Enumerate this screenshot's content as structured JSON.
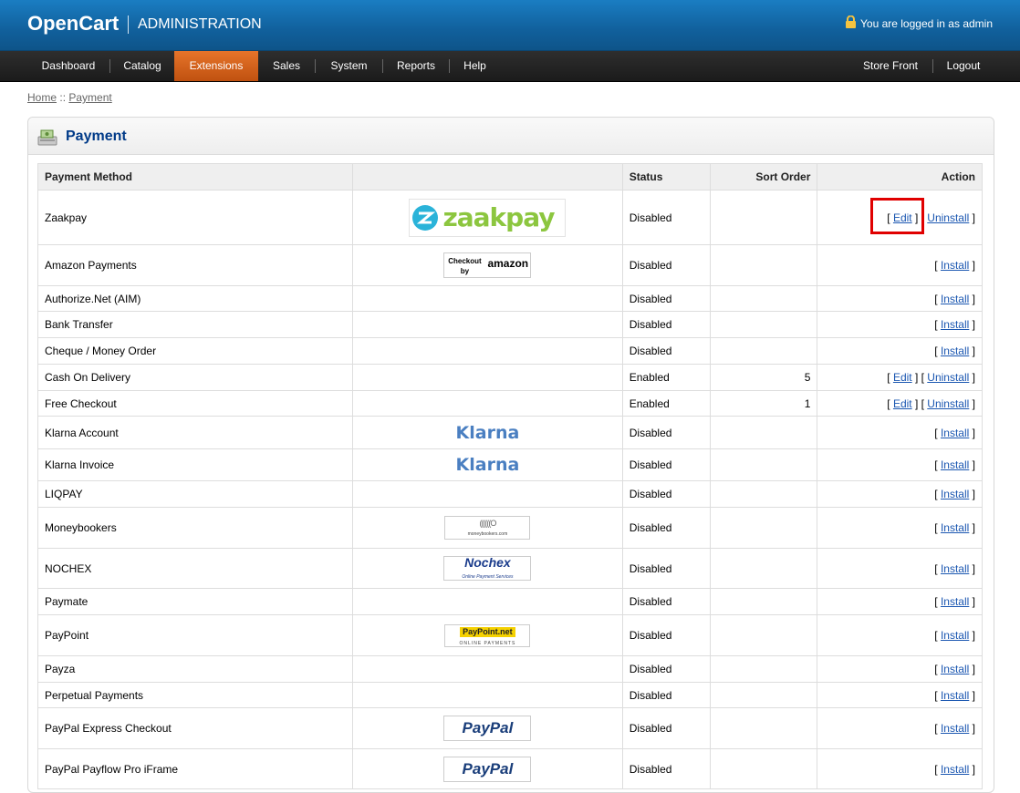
{
  "header": {
    "brand": "OpenCart",
    "subtitle": "ADMINISTRATION",
    "logged_in": "You are logged in as admin"
  },
  "menu": {
    "left": [
      "Dashboard",
      "Catalog",
      "Extensions",
      "Sales",
      "System",
      "Reports",
      "Help"
    ],
    "active": "Extensions",
    "right": [
      "Store Front",
      "Logout"
    ]
  },
  "breadcrumb": {
    "home": "Home",
    "sep": "::",
    "current": "Payment"
  },
  "page": {
    "title": "Payment"
  },
  "table": {
    "headers": [
      "Payment Method",
      "",
      "Status",
      "Sort Order",
      "Action"
    ],
    "rows": [
      {
        "name": "Zaakpay",
        "logo": "zaakpay",
        "status": "Disabled",
        "sort": "",
        "actions": [
          "Edit",
          "Uninstall"
        ]
      },
      {
        "name": "Amazon Payments",
        "logo": "amazon",
        "status": "Disabled",
        "sort": "",
        "actions": [
          "Install"
        ]
      },
      {
        "name": "Authorize.Net (AIM)",
        "logo": "",
        "status": "Disabled",
        "sort": "",
        "actions": [
          "Install"
        ]
      },
      {
        "name": "Bank Transfer",
        "logo": "",
        "status": "Disabled",
        "sort": "",
        "actions": [
          "Install"
        ]
      },
      {
        "name": "Cheque / Money Order",
        "logo": "",
        "status": "Disabled",
        "sort": "",
        "actions": [
          "Install"
        ]
      },
      {
        "name": "Cash On Delivery",
        "logo": "",
        "status": "Enabled",
        "sort": "5",
        "actions": [
          "Edit",
          "Uninstall"
        ]
      },
      {
        "name": "Free Checkout",
        "logo": "",
        "status": "Enabled",
        "sort": "1",
        "actions": [
          "Edit",
          "Uninstall"
        ]
      },
      {
        "name": "Klarna Account",
        "logo": "klarna",
        "status": "Disabled",
        "sort": "",
        "actions": [
          "Install"
        ]
      },
      {
        "name": "Klarna Invoice",
        "logo": "klarna",
        "status": "Disabled",
        "sort": "",
        "actions": [
          "Install"
        ]
      },
      {
        "name": "LIQPAY",
        "logo": "",
        "status": "Disabled",
        "sort": "",
        "actions": [
          "Install"
        ]
      },
      {
        "name": "Moneybookers",
        "logo": "moneybookers",
        "status": "Disabled",
        "sort": "",
        "actions": [
          "Install"
        ]
      },
      {
        "name": "NOCHEX",
        "logo": "nochex",
        "status": "Disabled",
        "sort": "",
        "actions": [
          "Install"
        ]
      },
      {
        "name": "Paymate",
        "logo": "",
        "status": "Disabled",
        "sort": "",
        "actions": [
          "Install"
        ]
      },
      {
        "name": "PayPoint",
        "logo": "paypoint",
        "status": "Disabled",
        "sort": "",
        "actions": [
          "Install"
        ]
      },
      {
        "name": "Payza",
        "logo": "",
        "status": "Disabled",
        "sort": "",
        "actions": [
          "Install"
        ]
      },
      {
        "name": "Perpetual Payments",
        "logo": "",
        "status": "Disabled",
        "sort": "",
        "actions": [
          "Install"
        ]
      },
      {
        "name": "PayPal Express Checkout",
        "logo": "paypal",
        "status": "Disabled",
        "sort": "",
        "actions": [
          "Install"
        ]
      },
      {
        "name": "PayPal Payflow Pro iFrame",
        "logo": "paypal",
        "status": "Disabled",
        "sort": "",
        "actions": [
          "Install"
        ]
      }
    ]
  },
  "logos": {
    "zaakpay": "zaakpay",
    "amazon_line1": "Checkout",
    "amazon_line2": "by",
    "amazon_brand": "amazon",
    "klarna": "Klarna",
    "moneybookers": "moneybookers.com",
    "nochex": "Nochex",
    "nochex_sub": "Online Payment Services",
    "paypoint": "PayPoint.net",
    "paypoint_sub": "ONLINE PAYMENTS",
    "paypal": "PayPal"
  },
  "colors": {
    "header_blue": "#11609c",
    "menu_active": "#d3611c",
    "title_blue": "#003a88",
    "link_blue": "#1b57b1",
    "highlight_red": "#e00000"
  }
}
